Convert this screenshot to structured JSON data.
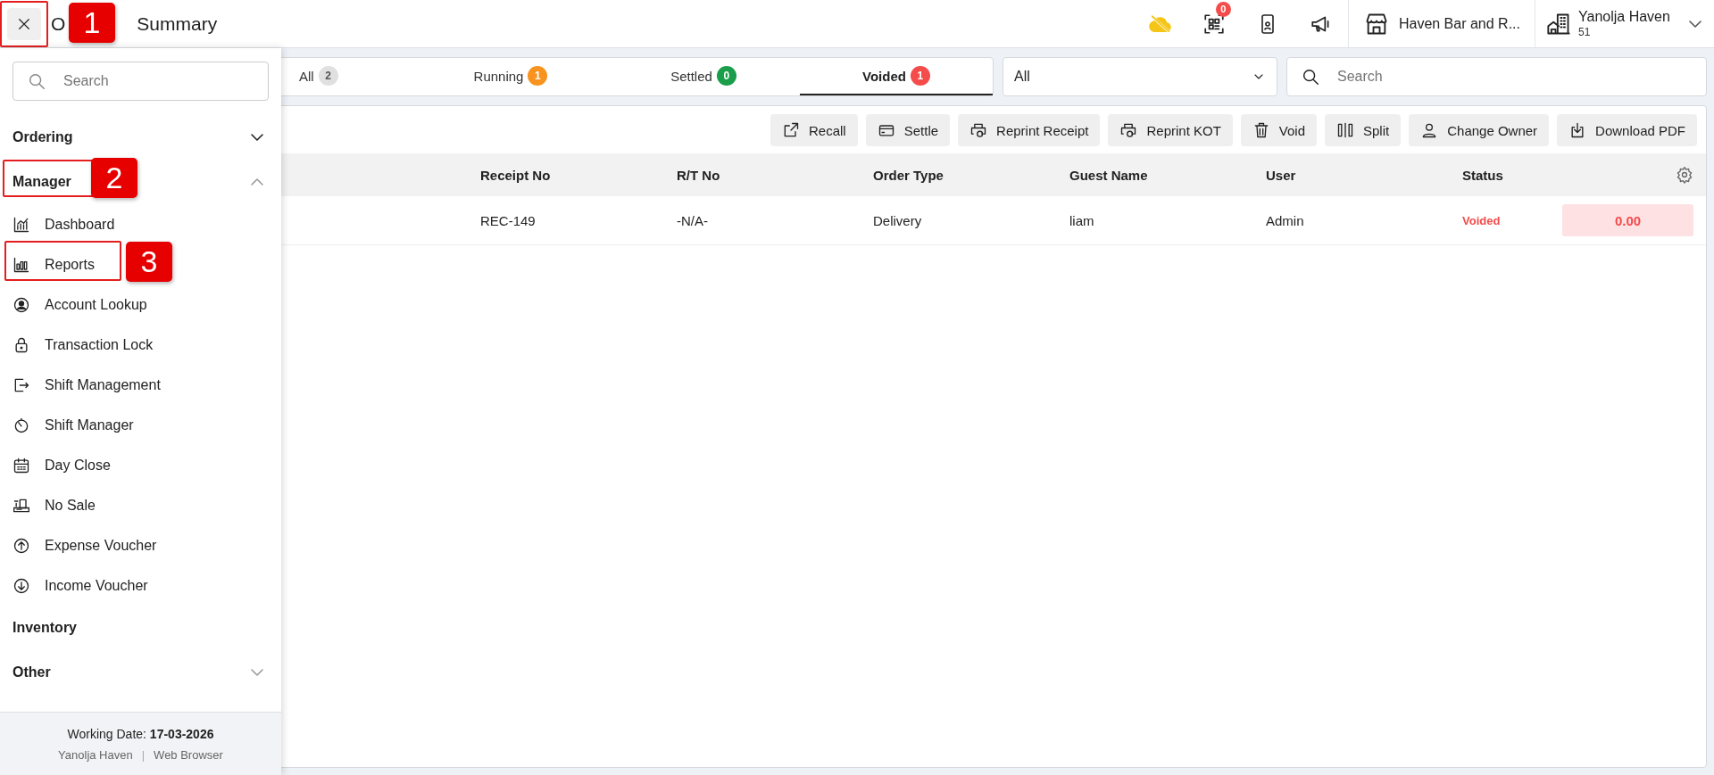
{
  "header": {
    "title_parts": [
      "O",
      "Summary"
    ],
    "notification_count": "0",
    "outlet": "Haven Bar and R...",
    "user": {
      "name": "Yanolja Haven",
      "id": "51"
    }
  },
  "sidebar": {
    "search": {
      "placeholder": "Search"
    },
    "sections": [
      {
        "label": "Ordering",
        "kind": "collapsible",
        "expanded": false
      },
      {
        "label": "Manager",
        "kind": "collapsible",
        "expanded": true,
        "annotation": "2",
        "items": [
          {
            "label": "Dashboard"
          },
          {
            "label": "Reports",
            "annotation": "3"
          },
          {
            "label": "Account Lookup"
          },
          {
            "label": "Transaction Lock"
          },
          {
            "label": "Shift Management"
          },
          {
            "label": "Shift Manager"
          },
          {
            "label": "Day Close"
          },
          {
            "label": "No Sale"
          },
          {
            "label": "Expense Voucher"
          },
          {
            "label": "Income Voucher"
          }
        ]
      },
      {
        "label": "Inventory",
        "kind": "plain"
      },
      {
        "label": "Other",
        "kind": "collapsible",
        "expanded": false
      }
    ],
    "footer": {
      "label": "Working Date:",
      "date": "17-03-2026",
      "user": "Yanolja Haven",
      "separator": "|",
      "client": "Web Browser"
    }
  },
  "close_button": {
    "annotation": "1"
  },
  "tabs": [
    {
      "label": "All",
      "count": "2",
      "color": "#e0e0e0",
      "selected": false
    },
    {
      "label": "Running",
      "count": "1",
      "color": "#f7931e",
      "selected": false
    },
    {
      "label": "Settled",
      "count": "0",
      "color": "#1a9e4b",
      "selected": false
    },
    {
      "label": "Voided",
      "count": "1",
      "color": "#f44b4b",
      "selected": true
    }
  ],
  "filter": {
    "value": "All"
  },
  "search": {
    "placeholder": "Search"
  },
  "toolbar": [
    "Recall",
    "Settle",
    "Reprint Receipt",
    "Reprint KOT",
    "Void",
    "Split",
    "Change Owner",
    "Download PDF"
  ],
  "table": {
    "columns": [
      "Receipt No",
      "R/T No",
      "Order Type",
      "Guest Name",
      "User",
      "Status"
    ],
    "rows": [
      {
        "cells": [
          "REC-149",
          "-N/A-",
          "Delivery",
          "liam",
          "Admin"
        ],
        "status": "Voided",
        "amount": "0.00"
      }
    ]
  }
}
